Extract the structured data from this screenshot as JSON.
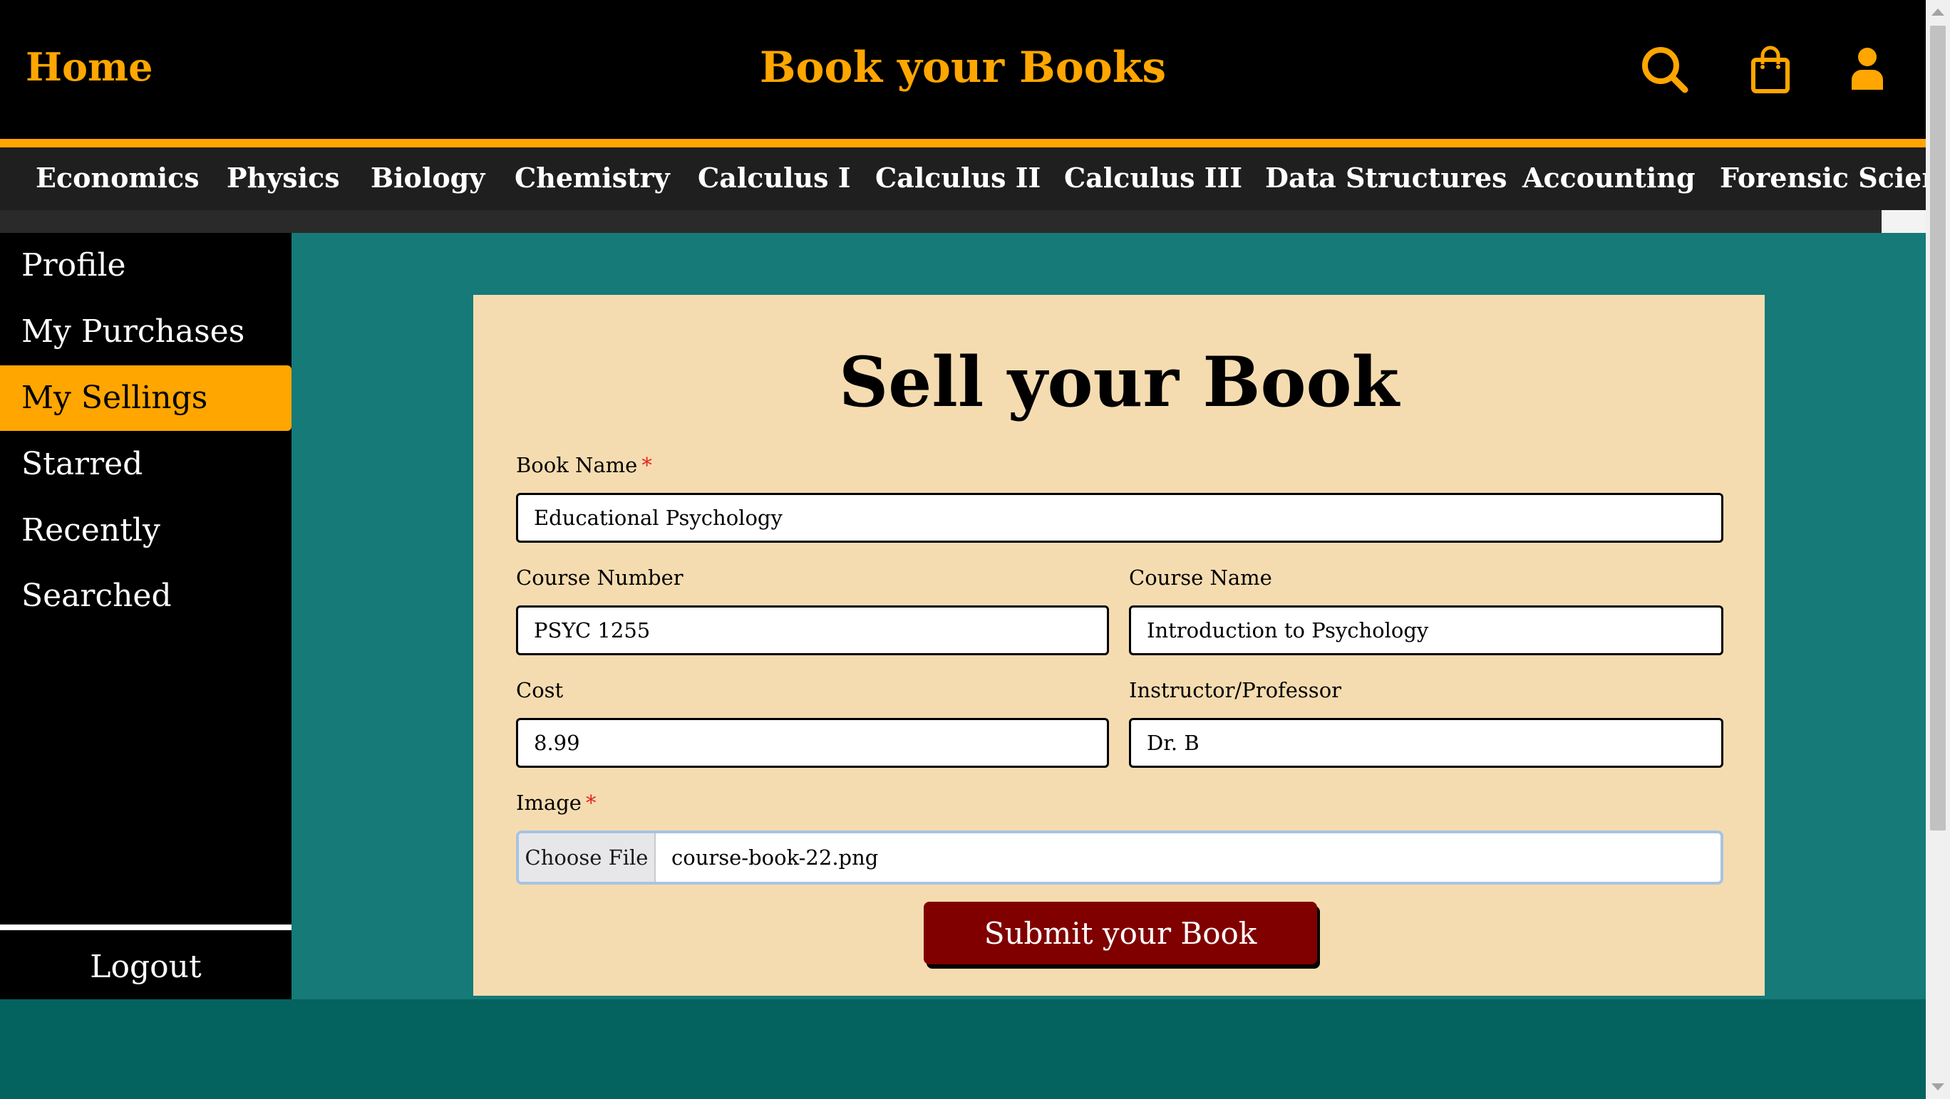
{
  "header": {
    "home_label": "Home",
    "brand": "Book your Books",
    "accent_color": "#ffa600",
    "icons": [
      "search-icon",
      "shopping-bag-icon",
      "user-icon"
    ]
  },
  "categories": [
    "Economics",
    "Physics",
    "Biology",
    "Chemistry",
    "Calculus I",
    "Calculus II",
    "Calculus III",
    "Data Structures",
    "Accounting",
    "Forensic Scienc"
  ],
  "sidebar": {
    "items": [
      {
        "label": "Profile",
        "active": false
      },
      {
        "label": "My Purchases",
        "active": false
      },
      {
        "label": "My Sellings",
        "active": true
      },
      {
        "label": "Starred",
        "active": false
      },
      {
        "label": "Recently Searched",
        "active": false
      }
    ],
    "logout_label": "Logout"
  },
  "form": {
    "title": "Sell your Book",
    "book_name": {
      "label": "Book Name",
      "required_mark": "*",
      "value": "Educational Psychology"
    },
    "course_number": {
      "label": "Course Number",
      "value": "PSYC 1255"
    },
    "course_name": {
      "label": "Course Name",
      "value": "Introduction to Psychology"
    },
    "cost": {
      "label": "Cost",
      "value": "8.99"
    },
    "instructor": {
      "label": "Instructor/Professor",
      "value": "Dr. B"
    },
    "image": {
      "label": "Image",
      "required_mark": "*",
      "button_label": "Choose File",
      "file_name": "course-book-22.png"
    },
    "submit_label": "Submit your Book"
  },
  "colors": {
    "main_bg": "#157a78",
    "card_bg": "#f5dcb0",
    "submit_bg": "#800000",
    "active_item": "#ffa600"
  }
}
